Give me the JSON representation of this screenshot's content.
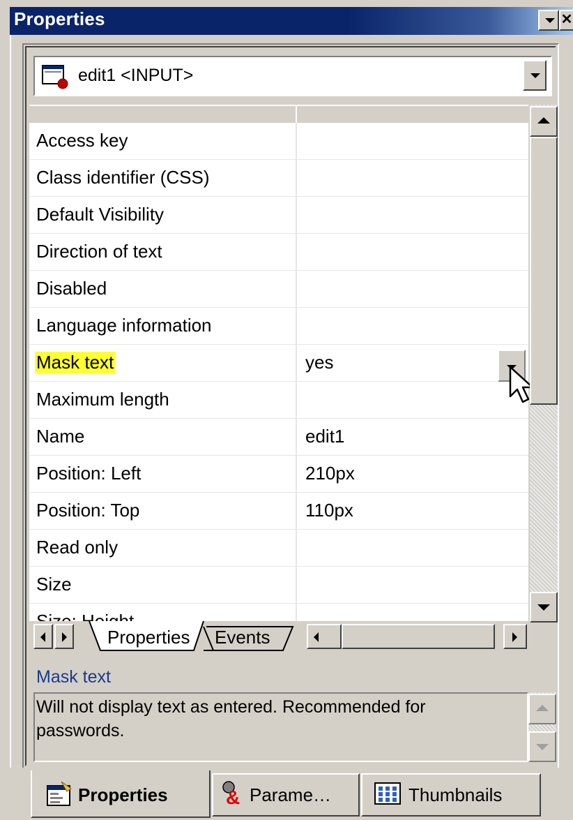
{
  "window": {
    "title": "Properties"
  },
  "element_selector": {
    "value": "edit1 <INPUT>"
  },
  "properties": [
    {
      "name": "Access key",
      "value": ""
    },
    {
      "name": "Class identifier (CSS)",
      "value": ""
    },
    {
      "name": "Default Visibility",
      "value": ""
    },
    {
      "name": "Direction of text",
      "value": ""
    },
    {
      "name": "Disabled",
      "value": ""
    },
    {
      "name": "Language information",
      "value": ""
    },
    {
      "name": "Mask text",
      "value": "yes",
      "selected": true
    },
    {
      "name": "Maximum length",
      "value": ""
    },
    {
      "name": "Name",
      "value": "edit1"
    },
    {
      "name": "Position: Left",
      "value": "210px"
    },
    {
      "name": "Position: Top",
      "value": "110px"
    },
    {
      "name": "Read only",
      "value": ""
    },
    {
      "name": "Size",
      "value": ""
    },
    {
      "name": "Size: Height",
      "value": ""
    }
  ],
  "grid_tabs": {
    "properties": "Properties",
    "events": "Events"
  },
  "description": {
    "title": "Mask text",
    "text": "Will not display text as entered. Recommended for passwords."
  },
  "dock_tabs": [
    {
      "label": "Properties",
      "active": true,
      "icon": "properties-icon"
    },
    {
      "label": "Parame…",
      "active": false,
      "icon": "parameters-icon"
    },
    {
      "label": "Thumbnails",
      "active": false,
      "icon": "thumbnails-icon"
    }
  ],
  "colors": {
    "highlight": "#ffff33",
    "titlebar": "#0a246a",
    "description_title": "#1a3a8c"
  }
}
